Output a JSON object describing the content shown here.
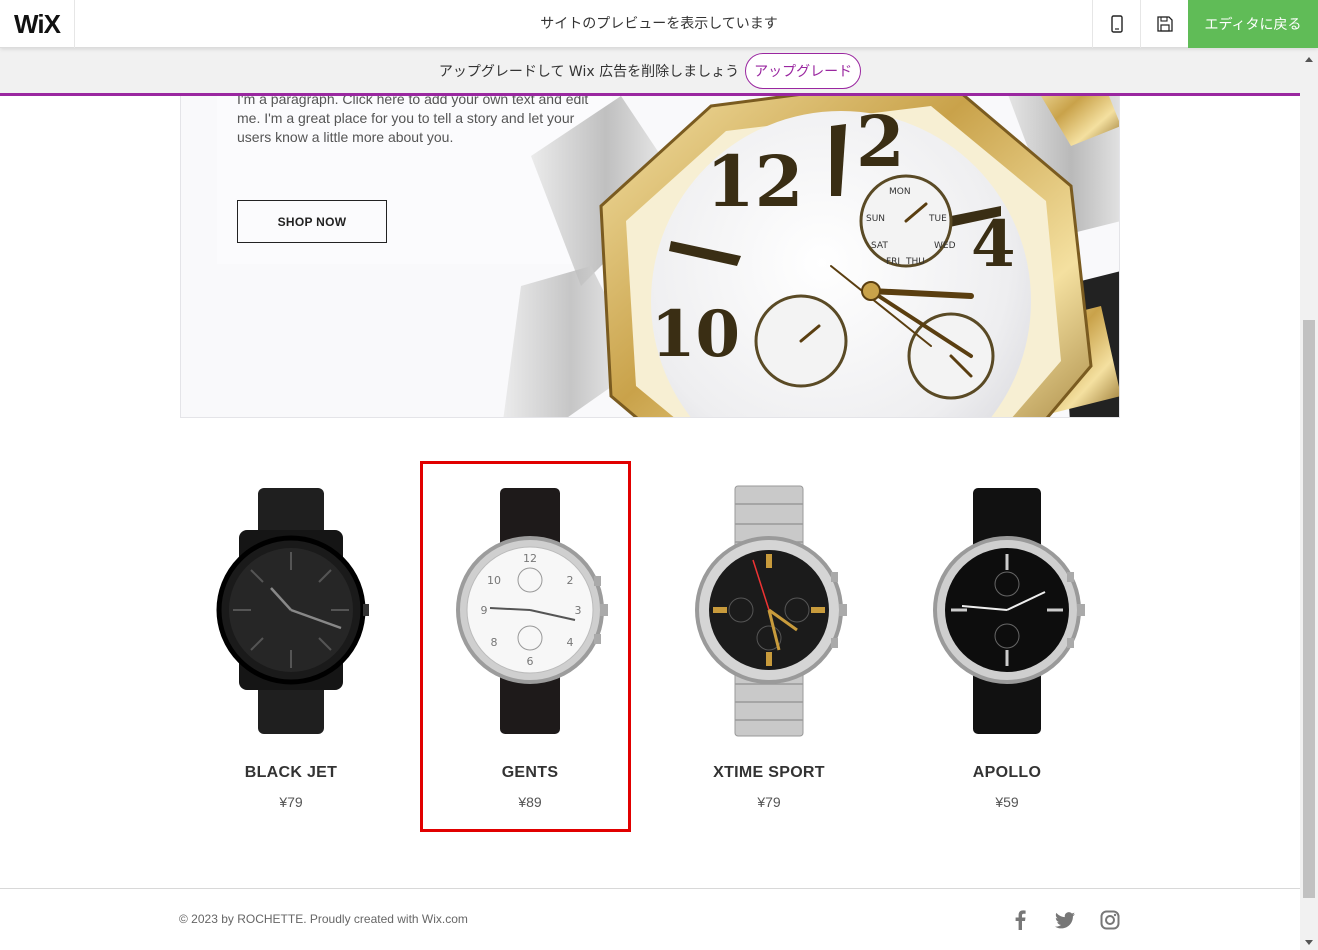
{
  "topbar": {
    "logo": "WiX",
    "preview_message": "サイトのプレビューを表示しています",
    "back_to_editor": "エディタに戻る",
    "icons": {
      "mobile": "mobile-view-icon",
      "save": "save-icon"
    }
  },
  "upgrade": {
    "text": "アップグレードして Wix 広告を削除しましょう",
    "button": "アップグレード"
  },
  "hero": {
    "paragraph": "I'm a paragraph. Click here to add your own text and edit me. I'm a great place for you to tell a story and let your users know a little more about you.",
    "shop_button": "SHOP NOW"
  },
  "products": [
    {
      "name": "BLACK JET",
      "price": "¥79"
    },
    {
      "name": "GENTS",
      "price": "¥89"
    },
    {
      "name": "XTIME SPORT",
      "price": "¥79"
    },
    {
      "name": "APOLLO",
      "price": "¥59"
    }
  ],
  "footer": {
    "copyright": "© 2023 by ROCHETTE. Proudly created with Wix.com",
    "social": [
      "facebook-icon",
      "twitter-icon",
      "instagram-icon"
    ]
  },
  "colors": {
    "accent_green": "#60bc57",
    "upgrade_purple": "#9a27a0",
    "highlight_red": "#e10000"
  }
}
